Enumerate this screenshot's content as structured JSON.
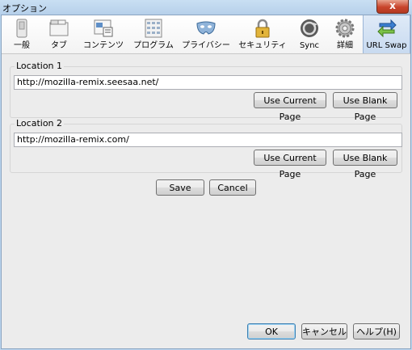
{
  "window": {
    "title": "オプション",
    "close_label": "x"
  },
  "toolbar": {
    "panes": [
      {
        "label": "一般",
        "icon": "general-switch-icon"
      },
      {
        "label": "タブ",
        "icon": "tabs-icon"
      },
      {
        "label": "コンテンツ",
        "icon": "content-icon"
      },
      {
        "label": "プログラム",
        "icon": "applications-icon"
      },
      {
        "label": "プライバシー",
        "icon": "privacy-mask-icon"
      },
      {
        "label": "セキュリティ",
        "icon": "security-lock-icon"
      },
      {
        "label": "Sync",
        "icon": "sync-icon"
      },
      {
        "label": "詳細",
        "icon": "advanced-gear-icon"
      },
      {
        "label": "URL Swap",
        "icon": "url-swap-arrows-icon",
        "selected": true
      }
    ]
  },
  "location1": {
    "label": "Location 1",
    "value": "http://mozilla-remix.seesaa.net/",
    "use_current_label": "Use Current Page",
    "use_blank_label": "Use Blank Page"
  },
  "location2": {
    "label": "Location 2",
    "value": "http://mozilla-remix.com/",
    "use_current_label": "Use Current Page",
    "use_blank_label": "Use Blank Page"
  },
  "actions": {
    "save_label": "Save",
    "cancel_label": "Cancel"
  },
  "footer": {
    "ok_label": "OK",
    "cancel_label": "キャンセル",
    "help_label": "ヘルプ(H)"
  }
}
